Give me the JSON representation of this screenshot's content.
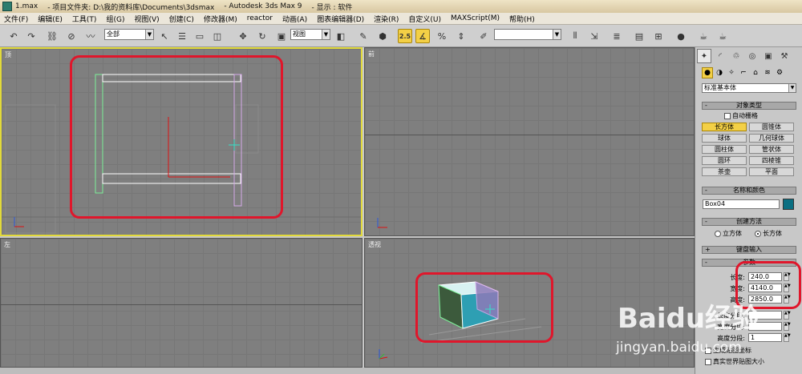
{
  "titlebar": {
    "file": "1.max",
    "project": "- 项目文件夹: D:\\我的资料库\\Documents\\3dsmax",
    "app": "- Autodesk 3ds Max 9",
    "display": "- 显示 : 软件"
  },
  "menu": [
    "文件(F)",
    "编辑(E)",
    "工具(T)",
    "组(G)",
    "视图(V)",
    "创建(C)",
    "修改器(M)",
    "reactor",
    "动画(A)",
    "图表编辑器(D)",
    "渲染(R)",
    "自定义(U)",
    "MAXScript(M)",
    "帮助(H)"
  ],
  "toolbar": {
    "selection_filter": "全部",
    "reference_coord": "视图",
    "snap_label": "2.5",
    "named_selection": ""
  },
  "viewports": {
    "top_left": "顶",
    "top_right": "前",
    "bottom_left": "左",
    "bottom_right": "透视"
  },
  "panel": {
    "category": "标准基本体",
    "object_type_title": "对象类型",
    "autogrid_label": "自动栅格",
    "object_buttons": [
      "长方体",
      "圆锥体",
      "球体",
      "几何球体",
      "圆柱体",
      "管状体",
      "圆环",
      "四棱锥",
      "茶壶",
      "平面"
    ],
    "selected_button": "长方体",
    "name_color_title": "名称和颜色",
    "object_name": "Box04",
    "object_color": "#0a6f82",
    "creation_method_title": "创建方法",
    "creation_options": [
      "立方体",
      "长方体"
    ],
    "creation_selected": "长方体",
    "keyboard_entry_title": "键盘输入",
    "params_title": "参数",
    "params": [
      {
        "label": "长度:",
        "value": "240.0"
      },
      {
        "label": "宽度:",
        "value": "4140.0"
      },
      {
        "label": "高度:",
        "value": "2850.0"
      }
    ],
    "segments": [
      {
        "label": "长度分段:",
        "value": ""
      },
      {
        "label": "宽度分段:",
        "value": ""
      },
      {
        "label": "高度分段:",
        "value": "1"
      }
    ],
    "gen_uv_label": "生成贴图坐标",
    "real_world_label": "真实世界贴图大小"
  },
  "watermark": {
    "brand": "Baidu经验",
    "url": "jingyan.baidu.com"
  }
}
